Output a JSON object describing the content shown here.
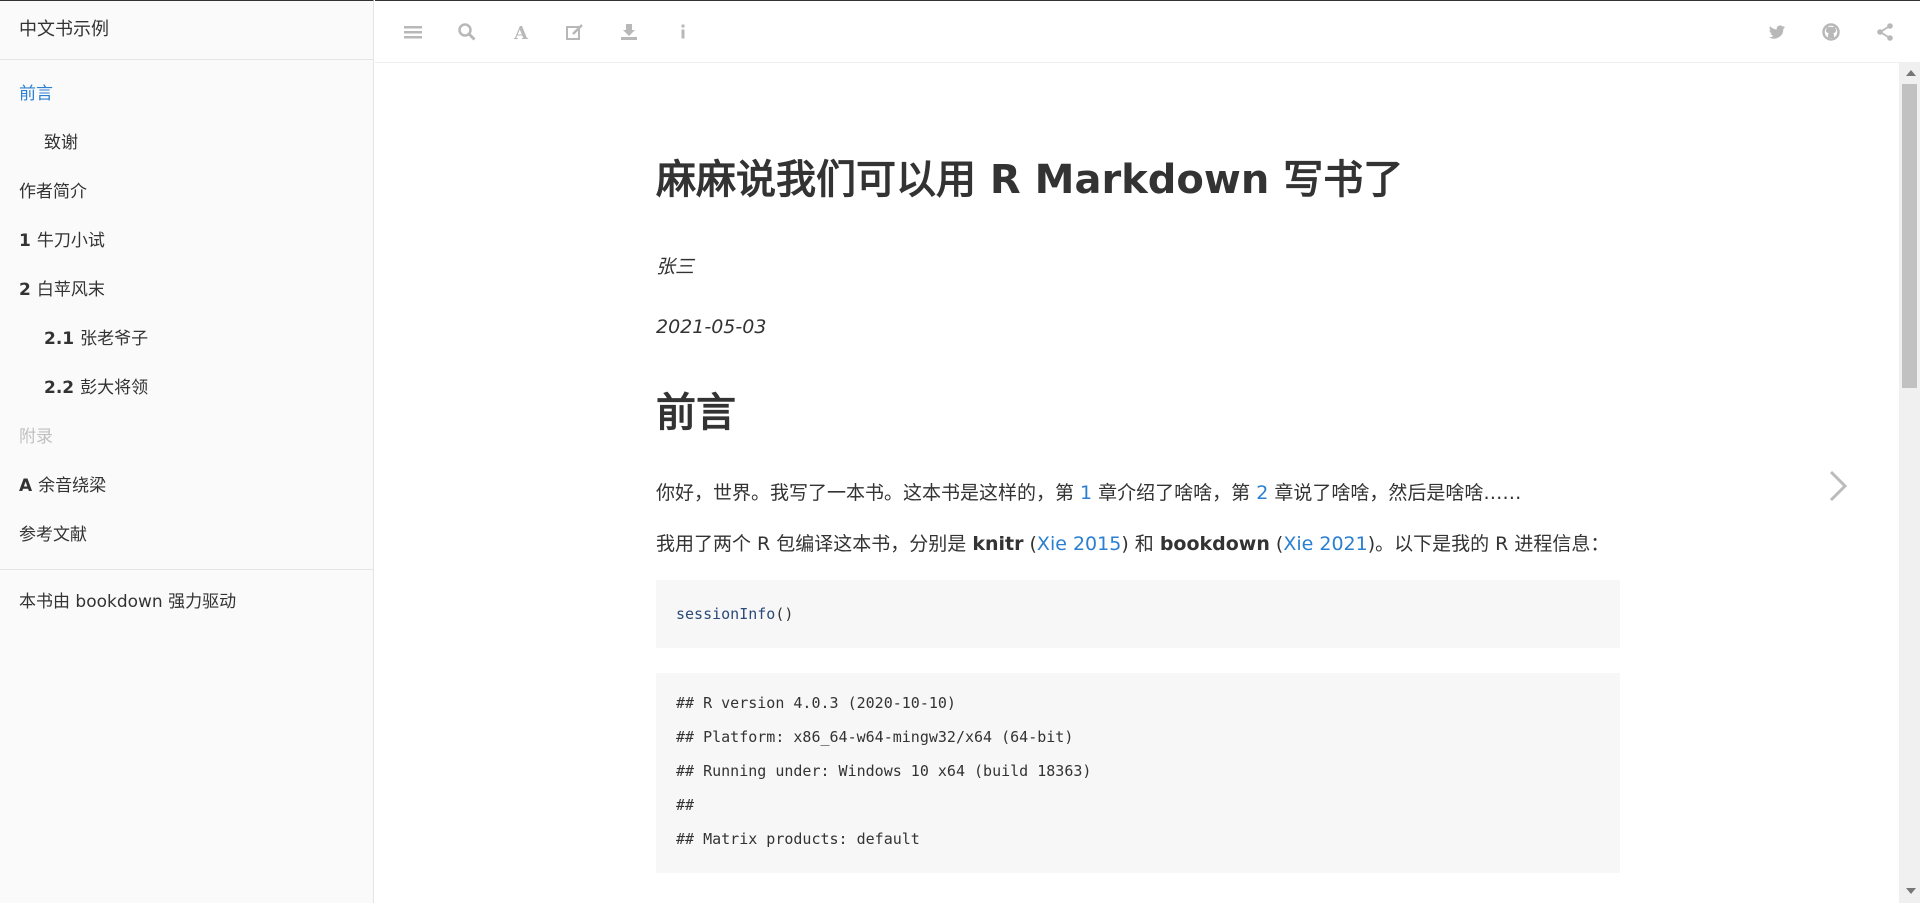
{
  "sidebar": {
    "title": "中文书示例",
    "items": [
      {
        "num": "",
        "label": "前言",
        "level": 0,
        "active": true
      },
      {
        "num": "",
        "label": "致谢",
        "level": 1
      },
      {
        "num": "",
        "label": "作者简介",
        "level": 0
      },
      {
        "num": "1",
        "label": "牛刀小试",
        "level": 0
      },
      {
        "num": "2",
        "label": "白苹风末",
        "level": 0
      },
      {
        "num": "2.1",
        "label": "张老爷子",
        "level": 1
      },
      {
        "num": "2.2",
        "label": "彭大将领",
        "level": 1
      },
      {
        "num": "",
        "label": "附录",
        "level": 0,
        "header": true
      },
      {
        "num": "A",
        "label": "余音绕梁",
        "level": 0
      },
      {
        "num": "",
        "label": "参考文献",
        "level": 0
      }
    ],
    "footer": "本书由 bookdown 强力驱动"
  },
  "toolbar": {
    "left_icons": [
      "menu-icon",
      "search-icon",
      "font-icon",
      "edit-icon",
      "download-icon",
      "info-icon"
    ],
    "right_icons": [
      "twitter-icon",
      "github-icon",
      "share-icon"
    ]
  },
  "page": {
    "title": "麻麻说我们可以用 R Markdown 写书了",
    "author": "张三",
    "date": "2021-05-03",
    "chapter": "前言",
    "para1": {
      "t1": "你好，世界。我写了一本书。这本书是这样的，第 ",
      "link1": "1",
      "t2": " 章介绍了啥啥，第 ",
      "link2": "2",
      "t3": " 章说了啥啥，然后是啥啥……"
    },
    "para2": {
      "t1": "我用了两个 R 包编译这本书，分别是 ",
      "pkg1": "knitr",
      "t2": " (",
      "cite1": "Xie 2015",
      "t3": ") 和 ",
      "pkg2": "bookdown",
      "t4": " (",
      "cite2": "Xie 2021",
      "t5": ")。以下是我的 R 进程信息："
    },
    "code_input": {
      "fn": "sessionInfo",
      "rest": "()"
    },
    "code_output": [
      "## R version 4.0.3 (2020-10-10)",
      "## Platform: x86_64-w64-mingw32/x64 (64-bit)",
      "## Running under: Windows 10 x64 (build 18363)",
      "##",
      "## Matrix products: default"
    ]
  },
  "colors": {
    "link": "#2a7fd1",
    "code_bg": "#f7f7f7"
  }
}
